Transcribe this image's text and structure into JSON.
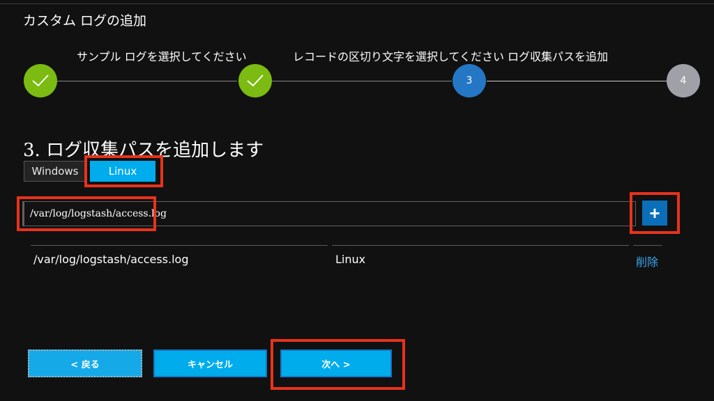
{
  "header": {
    "title": "カスタム ログの追加"
  },
  "wizard": {
    "steps": [
      {
        "label": "サンプル ログを選択してください",
        "state": "done",
        "marker": ""
      },
      {
        "label": "レコードの区切り文字を選択してください",
        "state": "done",
        "marker": ""
      },
      {
        "label": "ログ収集パスを追加",
        "state": "current",
        "marker": "3"
      },
      {
        "label": "",
        "state": "todo",
        "marker": "4"
      }
    ],
    "done_icon": "checkmark-icon",
    "colors": {
      "done": "#7bbb12",
      "current": "#2477c4",
      "todo": "#a0a0a8"
    }
  },
  "section": {
    "title": "3. ログ収集パスを追加します"
  },
  "os_tabs": [
    {
      "label": "Windows",
      "selected": false
    },
    {
      "label": "Linux",
      "selected": true
    }
  ],
  "path_input": {
    "value": "/var/log/logstash/access.log"
  },
  "add_button": {
    "icon": "plus-icon"
  },
  "paths_table": {
    "rows": [
      {
        "path": "/var/log/logstash/access.log",
        "os": "Linux",
        "action": "削除"
      }
    ]
  },
  "footer": {
    "back_label": "< 戻る",
    "cancel_label": "キャンセル",
    "next_label": "次へ >"
  },
  "highlight_color": "#e8321b",
  "accent_color": "#00acec"
}
